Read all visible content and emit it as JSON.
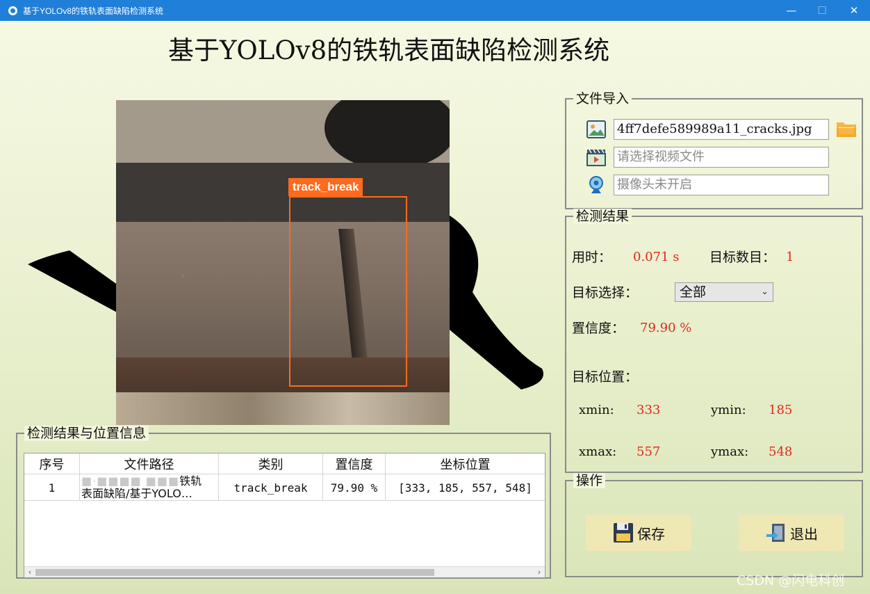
{
  "window": {
    "title": "基于YOLOv8的铁轨表面缺陷检测系统",
    "min_glyph": "—",
    "max_glyph": "☐",
    "close_glyph": "✕"
  },
  "heading": "基于YOLOv8的铁轨表面缺陷检测系统",
  "detection": {
    "label": "track_break",
    "box_color": "#ff6a1f"
  },
  "file_import": {
    "title": "文件导入",
    "image_value": "4ff7defe589989a11_cracks.jpg",
    "video_placeholder": "请选择视频文件",
    "camera_placeholder": "摄像头未开启"
  },
  "result": {
    "title": "检测结果",
    "time_label": "用时：",
    "time_value": "0.071 s",
    "count_label": "目标数目：",
    "count_value": "1",
    "select_label": "目标选择：",
    "select_value": "全部",
    "conf_label": "置信度：",
    "conf_value": "79.90 %",
    "pos_label": "目标位置：",
    "xmin_label": "xmin:",
    "xmin_value": "333",
    "ymin_label": "ymin:",
    "ymin_value": "185",
    "xmax_label": "xmax:",
    "xmax_value": "557",
    "ymax_label": "ymax:",
    "ymax_value": "548"
  },
  "ops": {
    "title": "操作",
    "save_label": "保存",
    "exit_label": "退出"
  },
  "table": {
    "title": "检测结果与位置信息",
    "headers": [
      "序号",
      "文件路径",
      "类别",
      "置信度",
      "坐标位置"
    ],
    "rows": [
      {
        "index": "1",
        "path_line1_blur": "■·■■■■  ■■■",
        "path_line1_visible": "铁轨",
        "path_line2": "表面缺陷/基于YOLO…",
        "class": "track_break",
        "conf": "79.90 %",
        "coords": "[333, 185, 557, 548]"
      }
    ],
    "scroll_left": "‹",
    "scroll_right": "›"
  },
  "watermark": "CSDN @闪电科创"
}
